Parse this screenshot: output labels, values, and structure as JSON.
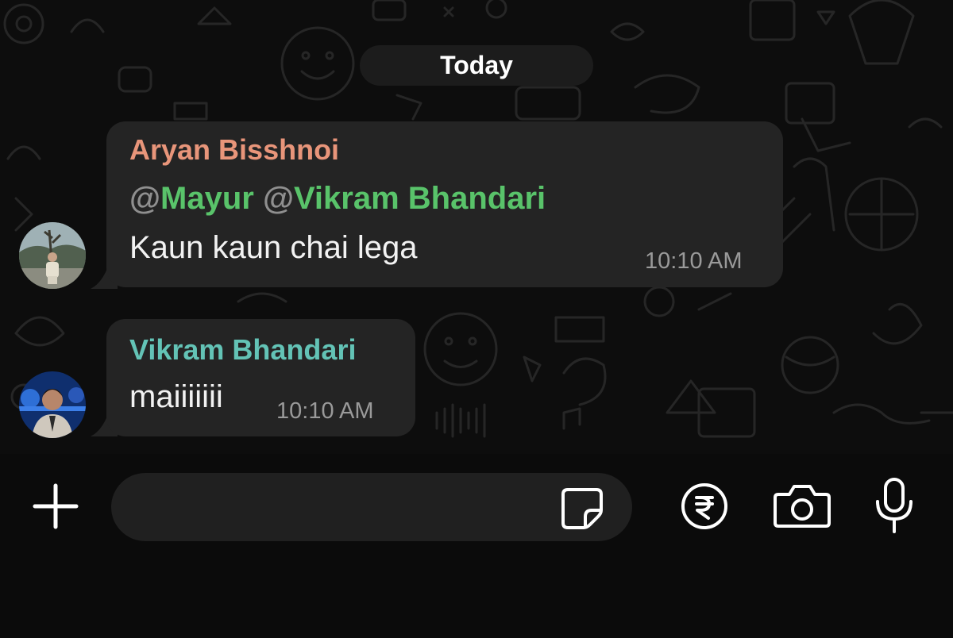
{
  "date_separator": "Today",
  "messages": [
    {
      "sender": "Aryan Bisshnoi",
      "sender_color": "#e8957a",
      "mentions": [
        {
          "at": "@",
          "name": "Mayur"
        },
        {
          "at": "@",
          "name": "Vikram Bhandari"
        }
      ],
      "mention_color": "#59c36a",
      "text": "Kaun kaun chai lega",
      "time": "10:10 AM"
    },
    {
      "sender": "Vikram Bhandari",
      "sender_color": "#63c3b6",
      "text": "maiiiiiii",
      "time": "10:10 AM"
    }
  ],
  "input_bar": {
    "attach_icon": "plus-icon",
    "sticker_icon": "sticker-icon",
    "payment_icon": "rupee-icon",
    "camera_icon": "camera-icon",
    "mic_icon": "microphone-icon",
    "message_value": ""
  }
}
